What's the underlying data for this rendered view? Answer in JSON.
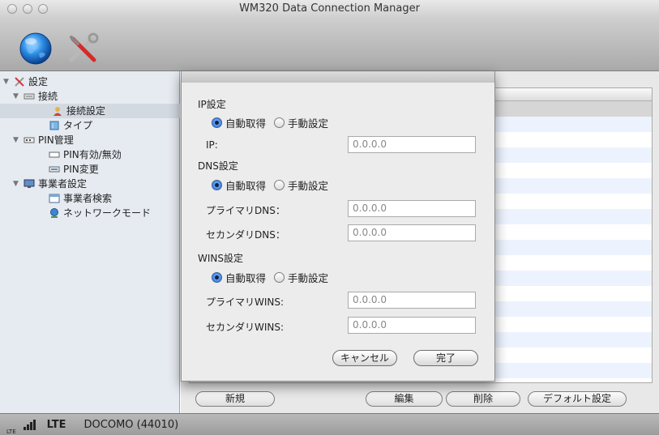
{
  "window": {
    "title": "WM320 Data Connection Manager"
  },
  "toolbar": {
    "connect_icon": "globe-icon",
    "settings_icon": "tools-icon"
  },
  "sidebar": {
    "items": [
      {
        "label": "設定",
        "icon": "tools-icon"
      },
      {
        "label": "接続",
        "icon": "network-icon"
      },
      {
        "label": "接続設定",
        "icon": "user-icon"
      },
      {
        "label": "タイプ",
        "icon": "type-icon"
      },
      {
        "label": "PIN管理",
        "icon": "pin-icon"
      },
      {
        "label": "PIN有効/無効",
        "icon": "pin-toggle-icon"
      },
      {
        "label": "PIN変更",
        "icon": "pin-change-icon"
      },
      {
        "label": "事業者設定",
        "icon": "monitor-icon"
      },
      {
        "label": "事業者検索",
        "icon": "search-window-icon"
      },
      {
        "label": "ネットワークモード",
        "icon": "network-mode-icon"
      }
    ]
  },
  "main": {
    "buttons": {
      "new": "新規",
      "edit": "編集",
      "delete": "削除",
      "default": "デフォルト設定"
    }
  },
  "dialog": {
    "ip": {
      "section": "IP設定",
      "auto": "自動取得",
      "manual": "手動設定",
      "label": "IP:",
      "value": "0.0.0.0"
    },
    "dns": {
      "section": "DNS設定",
      "auto": "自動取得",
      "manual": "手動設定",
      "primary_label": "プライマリDNS：",
      "primary_value": "0.0.0.0",
      "secondary_label": "セカンダリDNS：",
      "secondary_value": "0.0.0.0"
    },
    "wins": {
      "section": "WINS設定",
      "auto": "自動取得",
      "manual": "手動設定",
      "primary_label": "プライマリWINS:",
      "primary_value": "0.0.0.0",
      "secondary_label": "セカンダリWINS:",
      "secondary_value": "0.0.0.0"
    },
    "cancel": "キャンセル",
    "done": "完了"
  },
  "status": {
    "lte_small": "LTE",
    "network": "LTE",
    "carrier": "DOCOMO (44010)"
  }
}
